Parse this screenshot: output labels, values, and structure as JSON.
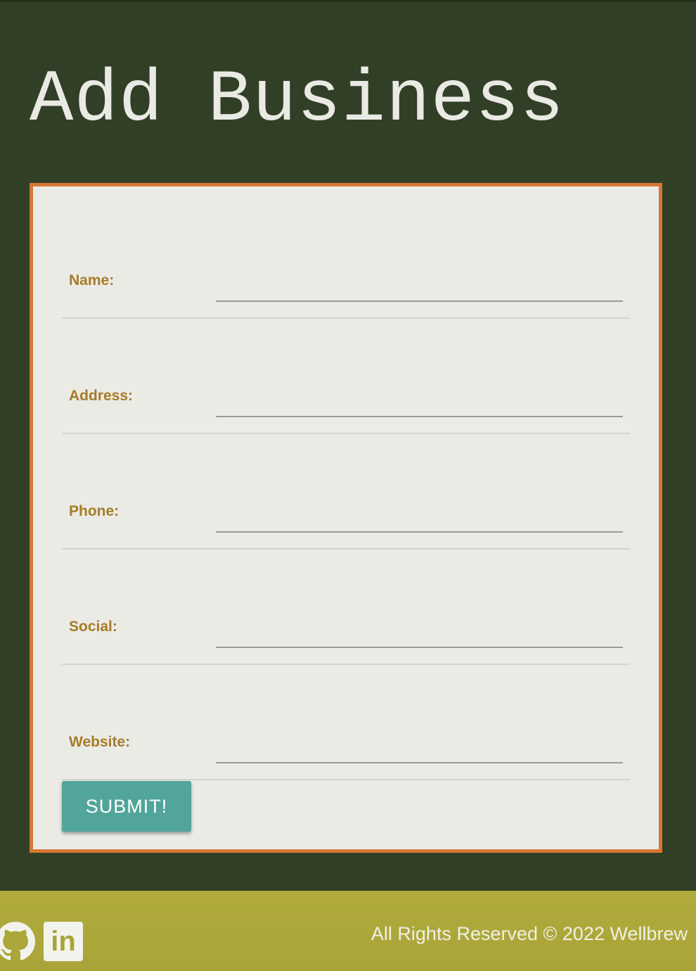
{
  "header": {
    "title": "Add Business"
  },
  "form": {
    "fields": [
      {
        "label": "Name:",
        "value": "",
        "placeholder": ""
      },
      {
        "label": "Address:",
        "value": "",
        "placeholder": ""
      },
      {
        "label": "Phone:",
        "value": "",
        "placeholder": ""
      },
      {
        "label": "Social:",
        "value": "",
        "placeholder": ""
      },
      {
        "label": "Website:",
        "value": "",
        "placeholder": ""
      }
    ],
    "submit_label": "SUBMIT!"
  },
  "footer": {
    "icons": [
      "github-icon",
      "linkedin-icon"
    ],
    "linkedin_glyph": "in",
    "copyright": "All Rights Reserved © 2022 Wellbrew"
  },
  "colors": {
    "background": "#323f27",
    "card_background": "#ebebe6",
    "card_border": "#d57833",
    "label": "#a67c28",
    "button": "#52a59a",
    "footer": "#b0ab3a"
  }
}
